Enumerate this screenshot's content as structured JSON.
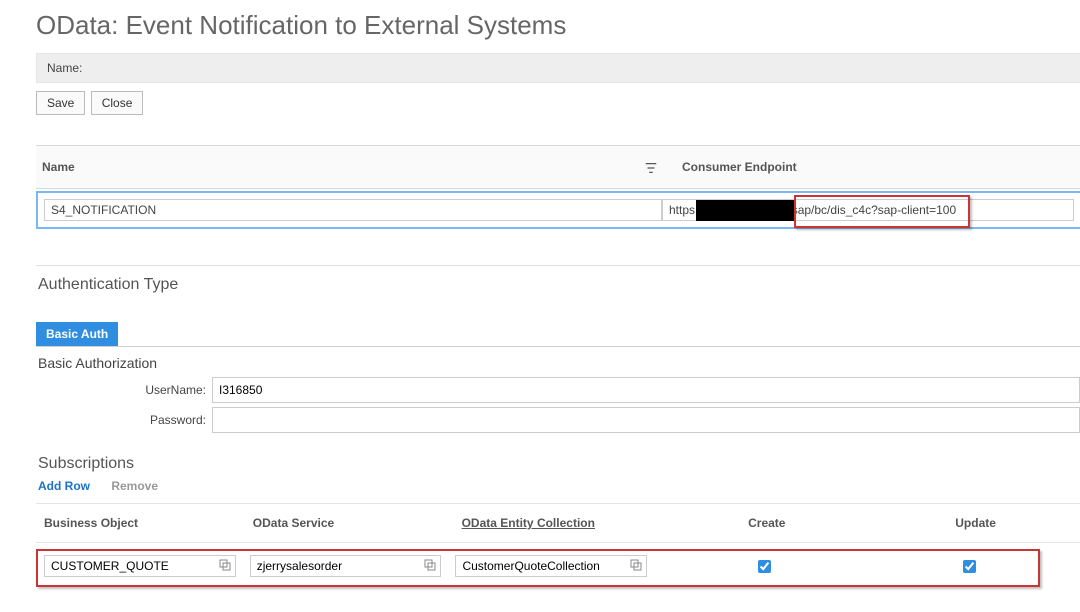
{
  "page_title": "OData: Event Notification to External Systems",
  "namebar_label": "Name:",
  "buttons": {
    "save": "Save",
    "close": "Close"
  },
  "grid": {
    "headers": {
      "name": "Name",
      "consumer_endpoint": "Consumer Endpoint"
    },
    "row": {
      "name_value": "S4_NOTIFICATION",
      "endpoint_value": "https://                          sap/bc/dis_c4c?sap-client=100"
    }
  },
  "auth": {
    "section_title": "Authentication Type",
    "tab_basic_auth": "Basic Auth",
    "basic_authorization_title": "Basic Authorization",
    "username_label": "UserName:",
    "username_value": "I316850",
    "password_label": "Password:",
    "password_value": ""
  },
  "subs": {
    "section_title": "Subscriptions",
    "add_row": "Add Row",
    "remove": "Remove",
    "headers": {
      "business_object": "Business Object",
      "odata_service": "OData Service",
      "odata_entity_collection": "OData Entity Collection",
      "create": "Create",
      "update": "Update"
    },
    "row": {
      "business_object": "CUSTOMER_QUOTE",
      "odata_service": "zjerrysalesorder",
      "odata_entity_collection": "CustomerQuoteCollection",
      "create_checked": true,
      "update_checked": true
    }
  }
}
